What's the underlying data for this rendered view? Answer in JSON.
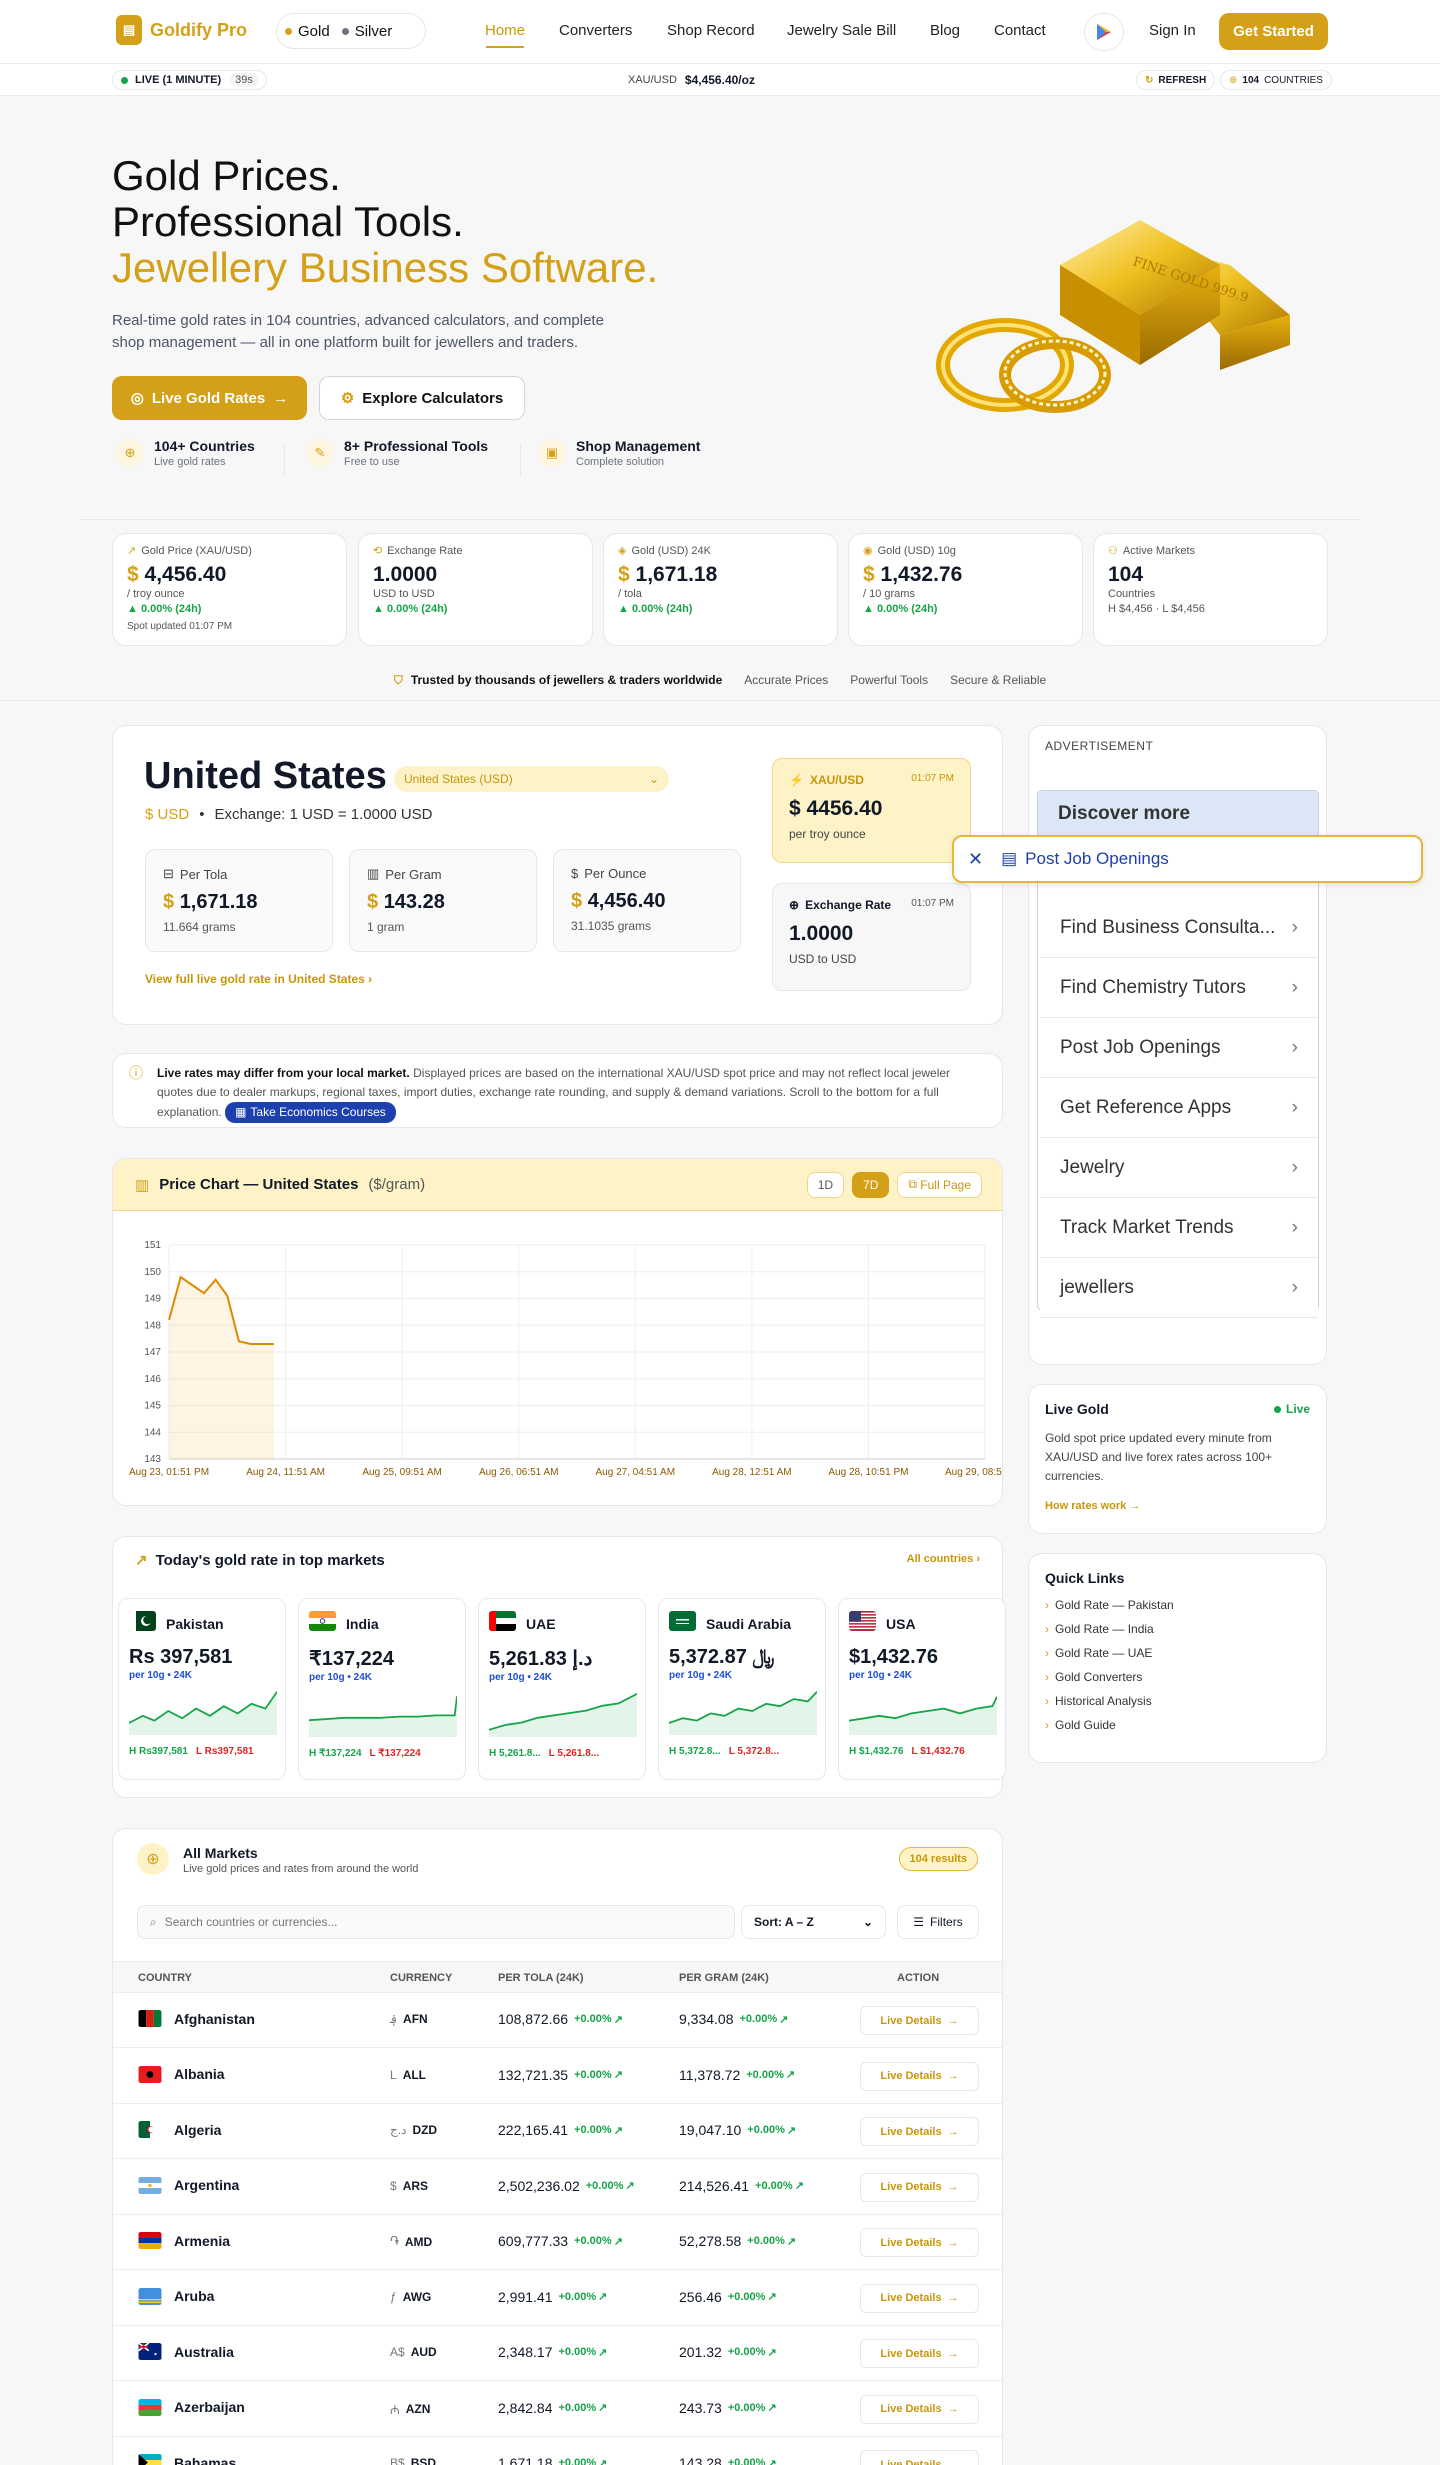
{
  "header": {
    "brand": "Goldify Pro",
    "metals": [
      "Gold",
      "Silver"
    ],
    "nav": [
      "Home",
      "Converters",
      "Shop Record",
      "Jewelry Sale Bill",
      "Blog",
      "Contact"
    ],
    "signin": "Sign In",
    "cta": "Get Started"
  },
  "ticker": {
    "live": "LIVE (1 MINUTE)",
    "countdown": "39s",
    "pair_label": "XAU/USD",
    "pair_value": "$4,456.40/oz",
    "refresh": "REFRESH",
    "countries_num": "104",
    "countries_label": "COUNTRIES"
  },
  "hero": {
    "line1": "Gold Prices.",
    "line2": "Professional Tools.",
    "line3": "Jewellery Business Software.",
    "desc": "Real-time gold rates in 104 countries, advanced calculators, and complete shop management — all in one platform built for jewellers and traders.",
    "btn_primary": "Live Gold Rates",
    "btn_secondary": "Explore Calculators",
    "bar_text": "FINE GOLD 999.9",
    "features": [
      {
        "title": "104+ Countries",
        "sub": "Live gold rates"
      },
      {
        "title": "8+ Professional Tools",
        "sub": "Free to use"
      },
      {
        "title": "Shop Management",
        "sub": "Complete solution"
      }
    ]
  },
  "stats": [
    {
      "label": "Gold Price (XAU/USD)",
      "cur": "$",
      "value": "4,456.40",
      "unit": "/ troy ounce",
      "change": "▲ 0.00% (24h)",
      "extra": "Spot updated 01:07 PM"
    },
    {
      "label": "Exchange Rate",
      "cur": "",
      "value": "1.0000",
      "unit": "USD to USD",
      "change": "▲ 0.00% (24h)",
      "extra": ""
    },
    {
      "label": "Gold (USD) 24K",
      "cur": "$",
      "value": "1,671.18",
      "unit": "/ tola",
      "change": "▲ 0.00% (24h)",
      "extra": ""
    },
    {
      "label": "Gold (USD) 10g",
      "cur": "$",
      "value": "1,432.76",
      "unit": "/ 10 grams",
      "change": "▲ 0.00% (24h)",
      "extra": ""
    },
    {
      "label": "Active Markets",
      "cur": "",
      "value": "104",
      "unit": "Countries",
      "change": "",
      "extra": "H $4,456 · L $4,456"
    }
  ],
  "trust": {
    "main": "Trusted by thousands of jewellers & traders worldwide",
    "items": [
      "Accurate Prices",
      "Powerful Tools",
      "Secure & Reliable"
    ]
  },
  "country": {
    "name": "United States",
    "selector": "United States (USD)",
    "currency": "$ USD",
    "exchange": "Exchange: 1 USD = 1.0000 USD",
    "boxes": [
      {
        "label": "Per Tola",
        "cur": "$",
        "value": "1,671.18",
        "sub": "11.664 grams"
      },
      {
        "label": "Per Gram",
        "cur": "$",
        "value": "143.28",
        "sub": "1 gram"
      },
      {
        "label": "Per Ounce",
        "cur": "$",
        "value": "4,456.40",
        "sub": "31.1035 grams"
      }
    ],
    "view_full": "View full live gold rate in United States",
    "xau": {
      "label": "XAU/USD",
      "time": "01:07 PM",
      "value": "$ 4456.40",
      "sub": "per troy ounce"
    },
    "exr": {
      "label": "Exchange Rate",
      "time": "01:07 PM",
      "value": "1.0000",
      "sub": "USD to USD"
    }
  },
  "disclaimer": {
    "bold": "Live rates may differ from your local market.",
    "text": "Displayed prices are based on the international XAU/USD spot price and may not reflect local jeweler quotes due to dealer markups, regional taxes, import duties, exchange rate rounding, and supply & demand variations. Scroll to the bottom for a full explanation.",
    "tag": "Take Economics Courses"
  },
  "chart": {
    "title": "Price Chart — United States",
    "unit": "($/gram)",
    "ranges": [
      "1D",
      "7D"
    ],
    "full": "Full Page"
  },
  "chart_data": {
    "type": "area",
    "title": "Price Chart — United States ($/gram)",
    "x_ticks": [
      "Aug 23, 01:51 PM",
      "Aug 24, 11:51 AM",
      "Aug 25, 09:51 AM",
      "Aug 26, 06:51 AM",
      "Aug 27, 04:51 AM",
      "Aug 28, 12:51 AM",
      "Aug 28, 10:51 PM",
      "Aug 29, 08:51 PM"
    ],
    "y_ticks": [
      151,
      150,
      149,
      148,
      147,
      146,
      145,
      144,
      143
    ],
    "ylim": [
      143,
      151
    ],
    "grid": true,
    "series": [
      {
        "values": [
          148.2,
          149.8,
          149.5,
          149.2,
          149.7,
          149.1,
          147.4,
          147.3,
          147.3,
          147.3
        ]
      }
    ]
  },
  "today": {
    "title": "Today's gold rate in top markets",
    "all": "All countries",
    "markets": [
      {
        "name": "Pakistan",
        "price": "Rs 397,581",
        "sub": "per 10g • 24K",
        "high": "H Rs397,581",
        "low": "L Rs397,581"
      },
      {
        "name": "India",
        "price": "₹137,224",
        "sub": "per 10g • 24K",
        "high": "H ₹137,224",
        "low": "L ₹137,224"
      },
      {
        "name": "UAE",
        "price": "5,261.83 د.إ",
        "sub": "per 10g • 24K",
        "high": "H 5,261.8...",
        "low": "L 5,261.8..."
      },
      {
        "name": "Saudi Arabia",
        "price": "5,372.87 ﷼",
        "sub": "per 10g • 24K",
        "high": "H 5,372.8...",
        "low": "L 5,372.8..."
      },
      {
        "name": "USA",
        "price": "$1,432.76",
        "sub": "per 10g • 24K",
        "high": "H $1,432.76",
        "low": "L $1,432.76"
      }
    ]
  },
  "markets": {
    "title": "All Markets",
    "sub": "Live gold prices and rates from around the world",
    "count": "104 results",
    "search_placeholder": "Search countries or currencies...",
    "sort": "Sort: A – Z",
    "filters": "Filters",
    "columns": [
      "COUNTRY",
      "CURRENCY",
      "PER TOLA (24K)",
      "PER GRAM (24K)",
      "ACTION"
    ],
    "rows": [
      {
        "country": "Afghanistan",
        "sym": "؋",
        "code": "AFN",
        "tola": "108,872.66",
        "gram": "9,334.08",
        "chg": "+0.00%"
      },
      {
        "country": "Albania",
        "sym": "L",
        "code": "ALL",
        "tola": "132,721.35",
        "gram": "11,378.72",
        "chg": "+0.00%"
      },
      {
        "country": "Algeria",
        "sym": "د.ج",
        "code": "DZD",
        "tola": "222,165.41",
        "gram": "19,047.10",
        "chg": "+0.00%"
      },
      {
        "country": "Argentina",
        "sym": "$",
        "code": "ARS",
        "tola": "2,502,236.02",
        "gram": "214,526.41",
        "chg": "+0.00%"
      },
      {
        "country": "Armenia",
        "sym": "֏",
        "code": "AMD",
        "tola": "609,777.33",
        "gram": "52,278.58",
        "chg": "+0.00%"
      },
      {
        "country": "Aruba",
        "sym": "ƒ",
        "code": "AWG",
        "tola": "2,991.41",
        "gram": "256.46",
        "chg": "+0.00%"
      },
      {
        "country": "Australia",
        "sym": "A$",
        "code": "AUD",
        "tola": "2,348.17",
        "gram": "201.32",
        "chg": "+0.00%"
      },
      {
        "country": "Azerbaijan",
        "sym": "₼",
        "code": "AZN",
        "tola": "2,842.84",
        "gram": "243.73",
        "chg": "+0.00%"
      },
      {
        "country": "Bahamas",
        "sym": "B$",
        "code": "BSD",
        "tola": "1,671.18",
        "gram": "143.28",
        "chg": "+0.00%"
      }
    ],
    "action": "Live Details"
  },
  "ad": {
    "label": "ADVERTISEMENT",
    "headline": "Discover more",
    "items": [
      "Find Business Consulta...",
      "Find Chemistry Tutors",
      "Post Job Openings",
      "Get Reference Apps",
      "Jewelry",
      "Track Market Trends",
      "jewellers"
    ],
    "overlay": "Post Job Openings"
  },
  "live_gold": {
    "title": "Live Gold",
    "badge": "Live",
    "text": "Gold spot price updated every minute from XAU/USD and live forex rates across 100+ currencies.",
    "link": "How rates work →"
  },
  "quick_links": {
    "title": "Quick Links",
    "items": [
      "Gold Rate — Pakistan",
      "Gold Rate — India",
      "Gold Rate — UAE",
      "Gold Converters",
      "Historical Analysis",
      "Gold Guide"
    ]
  },
  "colors": {
    "accent": "#d4a017",
    "positive": "#16a34a",
    "negative": "#dc2626",
    "link": "#1d4ed8"
  }
}
